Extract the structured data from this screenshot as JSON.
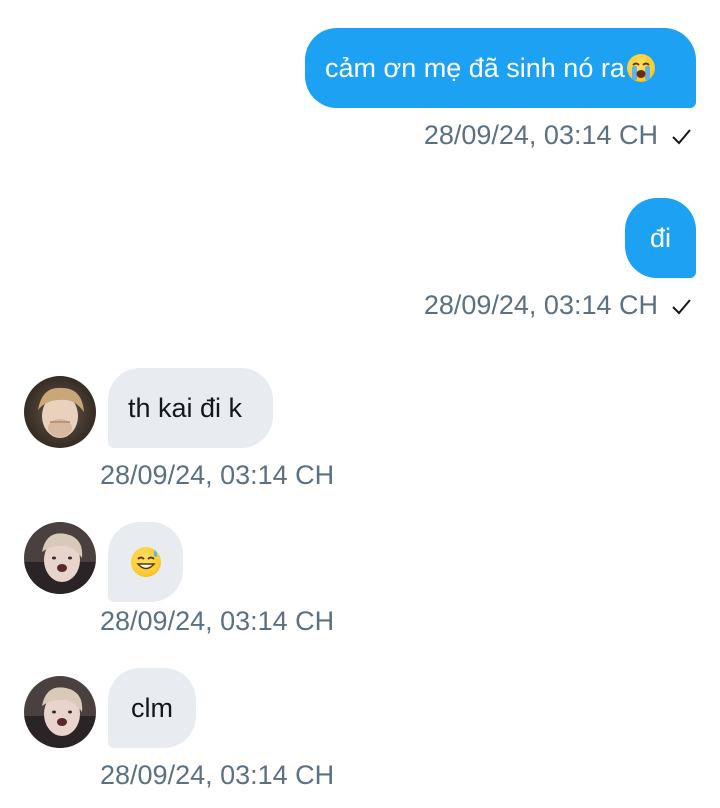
{
  "messages": [
    {
      "direction": "out",
      "text": "cảm ơn mẹ đã sinh nó ra",
      "emoji": "loudly-crying-face",
      "timestamp": "28/09/24, 03:14 CH",
      "read_receipt": "check-icon"
    },
    {
      "direction": "out",
      "text": "đi",
      "timestamp": "28/09/24, 03:14 CH",
      "read_receipt": "check-icon"
    },
    {
      "direction": "in",
      "text": "th kai đi k",
      "timestamp": "28/09/24, 03:14 CH"
    },
    {
      "direction": "in",
      "text": "",
      "emoji": "grinning-face-with-sweat",
      "timestamp": "28/09/24, 03:14 CH"
    },
    {
      "direction": "in",
      "text": "clm",
      "timestamp": "28/09/24, 03:14 CH"
    }
  ],
  "colors": {
    "outgoing_bubble": "#1da1f2",
    "incoming_bubble": "#e8ecf0",
    "timestamp": "#5b7083",
    "text_dark": "#14171a"
  }
}
